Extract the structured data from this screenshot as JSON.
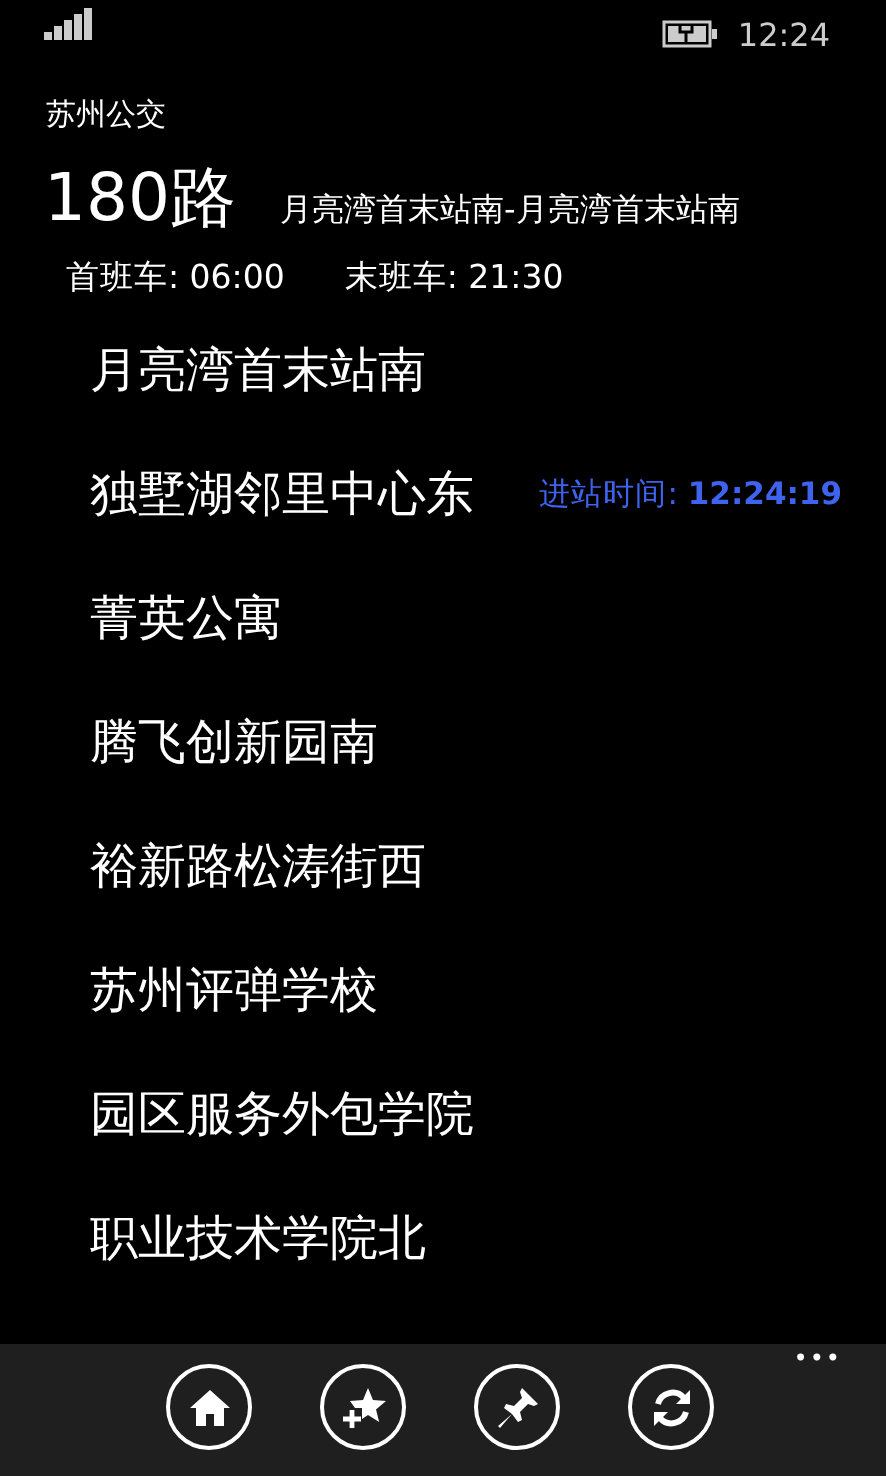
{
  "status_bar": {
    "time": "12:24"
  },
  "app_title": "苏州公交",
  "route": {
    "number": "180路",
    "name": "月亮湾首末站南-月亮湾首末站南",
    "first_bus": "首班车: 06:00",
    "last_bus": "末班车: 21:30"
  },
  "stops": [
    {
      "name": "月亮湾首末站南"
    },
    {
      "name": "独墅湖邻里中心东",
      "arrival": "进站时间: **12:24:19**"
    },
    {
      "name": "菁英公寓"
    },
    {
      "name": "腾飞创新园南"
    },
    {
      "name": "裕新路松涛街西"
    },
    {
      "name": "苏州评弹学校"
    },
    {
      "name": "园区服务外包学院"
    },
    {
      "name": "职业技术学院北"
    }
  ],
  "app_bar": {
    "buttons": [
      {
        "kind": "home"
      },
      {
        "kind": "favorite"
      },
      {
        "kind": "pin"
      },
      {
        "kind": "refresh"
      }
    ],
    "more": "•••"
  }
}
